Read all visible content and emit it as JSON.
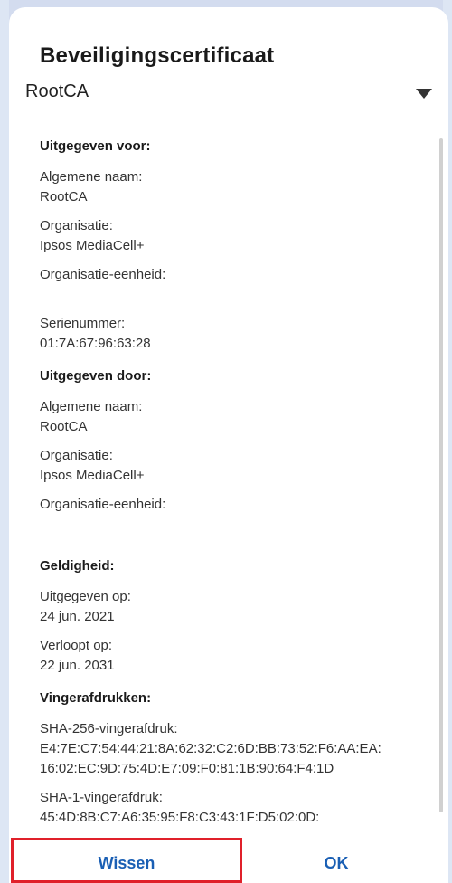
{
  "dialog": {
    "title": "Beveiligingscertificaat",
    "selector": {
      "value": "RootCA",
      "icon": "dropdown-arrow-icon"
    }
  },
  "issued_to": {
    "header": "Uitgegeven voor:",
    "common_name_label": "Algemene naam:",
    "common_name": "RootCA",
    "org_label": "Organisatie:",
    "org": "Ipsos MediaCell+",
    "org_unit_label": "Organisatie-eenheid:",
    "org_unit": "",
    "serial_label": "Serienummer:",
    "serial": "01:7A:67:96:63:28"
  },
  "issued_by": {
    "header": "Uitgegeven door:",
    "common_name_label": "Algemene naam:",
    "common_name": "RootCA",
    "org_label": "Organisatie:",
    "org": "Ipsos MediaCell+",
    "org_unit_label": "Organisatie-eenheid:",
    "org_unit": ""
  },
  "validity": {
    "header": "Geldigheid:",
    "issued_on_label": "Uitgegeven op:",
    "issued_on": "24 jun. 2021",
    "expires_label": "Verloopt op:",
    "expires": "22 jun. 2031"
  },
  "fingerprints": {
    "header": "Vingerafdrukken:",
    "sha256_label": "SHA-256-vingerafdruk:",
    "sha256_line1": "E4:7E:C7:54:44:21:8A:62:32:C2:6D:BB:73:52:F6:AA:EA:",
    "sha256_line2": "16:02:EC:9D:75:4D:E7:09:F0:81:1B:90:64:F4:1D",
    "sha1_label": "SHA-1-vingerafdruk:",
    "sha1_line1": "45:4D:8B:C7:A6:35:95:F8:C3:43:1F:D5:02:0D:"
  },
  "buttons": {
    "clear": "Wissen",
    "ok": "OK"
  },
  "colors": {
    "button_text": "#1a5fb4",
    "highlight": "#e0202a",
    "background": "#d3dcef"
  }
}
